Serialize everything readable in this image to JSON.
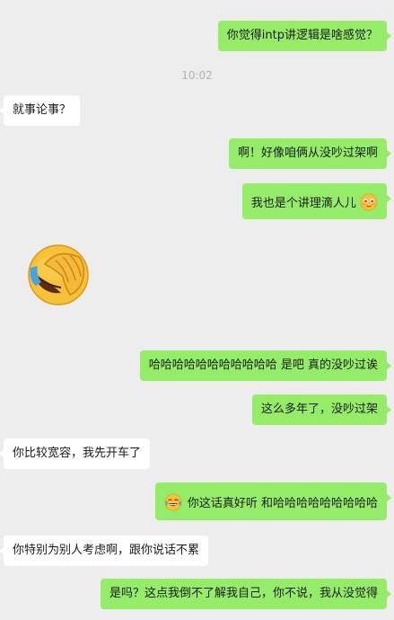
{
  "timestamp": "10:02",
  "messages": [
    {
      "text": "你觉得intp讲逻辑是啥感觉？",
      "side": "out"
    },
    {
      "text": "就事论事？",
      "side": "in"
    },
    {
      "text": "啊！好像咱俩从没吵过架啊",
      "side": "out"
    },
    {
      "text": "我也是个讲理滴人儿",
      "side": "out",
      "emoji": "blushing-face-icon"
    },
    {
      "sticker": "facepalm-laughing-sticker",
      "side": "in"
    },
    {
      "text": "哈哈哈哈哈哈哈哈哈哈哈 是吧 真的没吵过诶",
      "side": "out"
    },
    {
      "text": "这么多年了，没吵过架",
      "side": "out"
    },
    {
      "text": "你比较宽容，我先开车了",
      "side": "in"
    },
    {
      "text": "你这话真好听 和哈哈哈哈哈哈哈哈哈",
      "side": "out",
      "emoji": "tears-of-joy-icon"
    },
    {
      "text": "你特别为别人考虑啊，跟你说话不累",
      "side": "in"
    },
    {
      "text": "是吗？这点我倒不了解我自己，你不说，我从没觉得",
      "side": "out"
    }
  ],
  "colors": {
    "background": "#ededed",
    "outgoing_bubble": "#95ec69",
    "incoming_bubble": "#ffffff",
    "timestamp": "#b2b2b2"
  }
}
